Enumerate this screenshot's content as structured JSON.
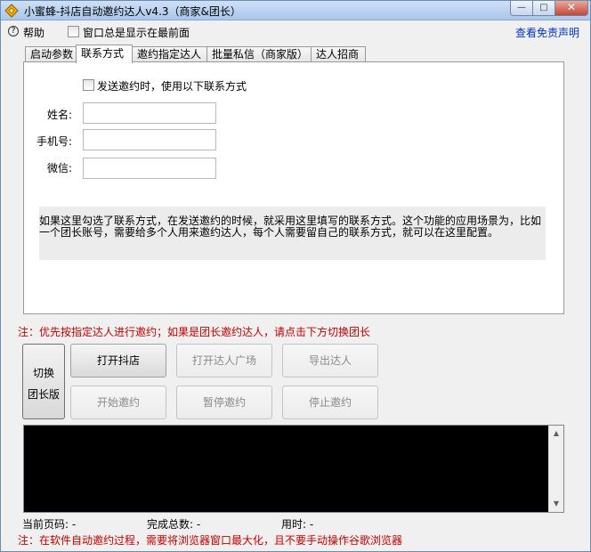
{
  "window": {
    "title": "小蜜蜂-抖店自动邀约达人v4.3（商家&团长）",
    "controls": {
      "minimize": "—",
      "maximize": "□",
      "close": "✕"
    }
  },
  "menu": {
    "help": "帮助",
    "always_on_top": "窗口总是显示在最前面",
    "disclaimer": "查看免责声明"
  },
  "tabs": [
    {
      "label": "启动参数"
    },
    {
      "label": "联系方式"
    },
    {
      "label": "邀约指定达人"
    },
    {
      "label": "批量私信（商家版）"
    },
    {
      "label": "达人招商"
    }
  ],
  "contact_panel": {
    "checkbox_label": "发送邀约时，使用以下联系方式",
    "name_label": "姓名:",
    "phone_label": "手机号:",
    "wechat_label": "微信:",
    "name_value": "",
    "phone_value": "",
    "wechat_value": "",
    "info_text": "如果这里勾选了联系方式，在发送邀约的时候，就采用这里填写的联系方式。这个功能的应用场景为，比如一个团长账号，需要给多个人用来邀约达人，每个人需要留自己的联系方式，就可以在这里配置。"
  },
  "notice_top": "注：优先按指定达人进行邀约；如果是团长邀约达人，请点击下方切换团长",
  "buttons": {
    "switch_line1": "切换",
    "switch_line2": "团长版",
    "open_store": "打开抖店",
    "open_square": "打开达人广场",
    "export": "导出达人",
    "start": "开始邀约",
    "pause": "暂停邀约",
    "stop": "停止邀约"
  },
  "status": {
    "page_label": "当前页码: -",
    "total_label": "完成总数: -",
    "time_label": "用时: -"
  },
  "notice_bottom": "注：在软件自动邀约过程，需要将浏览器窗口最大化，且不要手动操作谷歌浏览器",
  "colors": {
    "notice": "#cc0000",
    "link": "#0033cc",
    "console_bg": "#000000"
  }
}
